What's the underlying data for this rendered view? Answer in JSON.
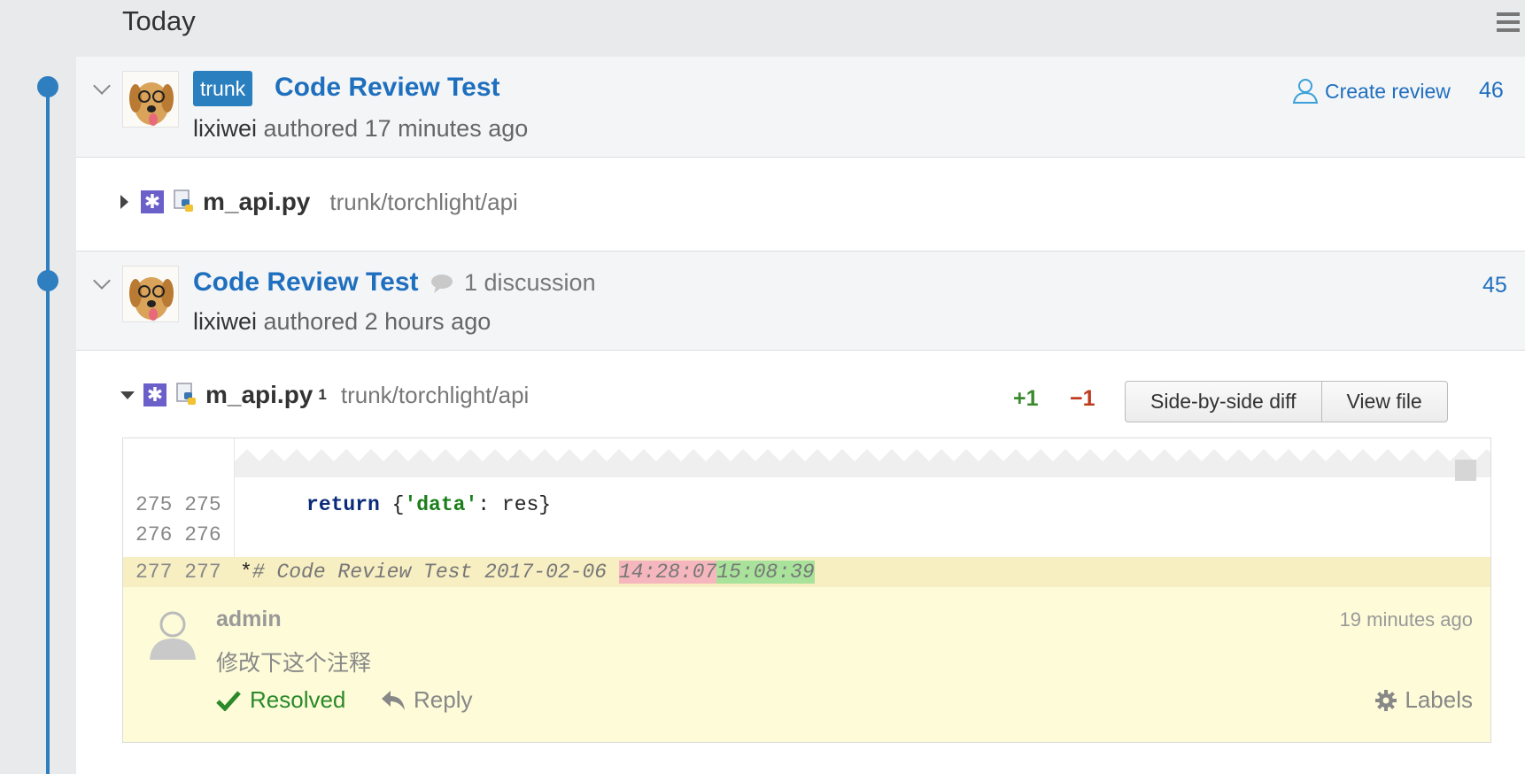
{
  "header": {
    "title": "Today"
  },
  "commits": [
    {
      "branch": "trunk",
      "title": "Code Review Test",
      "author": "lixiwei",
      "action": "authored 17 minutes ago",
      "create_review": "Create review",
      "number": "46",
      "file": {
        "name": "m_api.py",
        "path": "trunk/torchlight/api"
      }
    },
    {
      "title": "Code Review Test",
      "discussion": "1 discussion",
      "author": "lixiwei",
      "action": "authored 2 hours ago",
      "number": "45",
      "file": {
        "name": "m_api.py",
        "badge": "1",
        "path": "trunk/torchlight/api",
        "added": "+1",
        "removed": "−1",
        "side_by_side": "Side-by-side diff",
        "view_file": "View file"
      }
    }
  ],
  "diff": {
    "lines": [
      {
        "old": "275",
        "new": "275",
        "indent": "     ",
        "kw": "return",
        "pre": " {",
        "str": "'data'",
        "post": ": res}"
      },
      {
        "old": "276",
        "new": "276"
      },
      {
        "old": "277",
        "new": "277",
        "marker": "*",
        "comment": "# Code Review Test 2017-02-06 ",
        "removed": "14:28:07",
        "added": "15:08:39"
      }
    ]
  },
  "comment": {
    "user": "admin",
    "time": "19 minutes ago",
    "text": "修改下这个注释",
    "resolved": "Resolved",
    "reply": "Reply",
    "labels": "Labels"
  },
  "colors": {
    "accent": "#1f6fbf",
    "timeline": "#2f7fc0",
    "highlight": "#f7eec2",
    "comment_bg": "#fdfbd8"
  }
}
